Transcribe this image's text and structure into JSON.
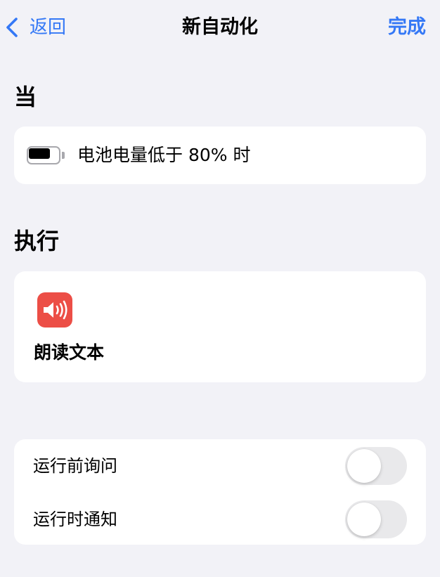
{
  "nav": {
    "back_label": "返回",
    "title": "新自动化",
    "done_label": "完成",
    "accent_color": "#3478f6"
  },
  "trigger_section": {
    "title": "当",
    "trigger": {
      "icon": "battery-icon",
      "battery_level": 0.8,
      "text": "电池电量低于 80% 时"
    }
  },
  "action_section": {
    "title": "执行",
    "action": {
      "icon": "speaker-icon",
      "icon_color": "#ec4e46",
      "label": "朗读文本"
    }
  },
  "options": [
    {
      "label": "运行前询问",
      "enabled": false
    },
    {
      "label": "运行时通知",
      "enabled": false
    }
  ]
}
